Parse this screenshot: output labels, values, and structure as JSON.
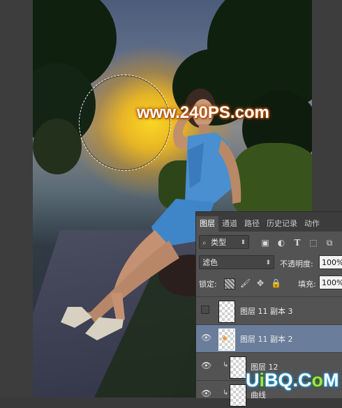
{
  "watermarks": {
    "top": "www.240PS.com",
    "bottom_part1": "U",
    "bottom_part2": "i",
    "bottom_part3": "BQ.C",
    "bottom_part4": "o",
    "bottom_part5": "M"
  },
  "layers_panel": {
    "tabs": [
      {
        "label": "图层",
        "active": true
      },
      {
        "label": "通道",
        "active": false
      },
      {
        "label": "路径",
        "active": false
      },
      {
        "label": "历史记录",
        "active": false
      },
      {
        "label": "动作",
        "active": false
      }
    ],
    "filter": {
      "label": "类型",
      "icon": "search-icon"
    },
    "blend_mode": "滤色",
    "opacity_label": "不透明度:",
    "opacity_value": "100%",
    "lock_label": "锁定:",
    "fill_label": "填充:",
    "fill_value": "100%",
    "layers": [
      {
        "name": "图层 11 副本 3",
        "visible": false,
        "selected": false,
        "clipped": false
      },
      {
        "name": "图层 11 副本 2",
        "visible": true,
        "selected": true,
        "clipped": false
      },
      {
        "name": "图层 12",
        "visible": true,
        "selected": false,
        "clipped": true
      },
      {
        "name": "曲线",
        "visible": true,
        "selected": false,
        "clipped": true
      }
    ]
  },
  "colors": {
    "panel_bg": "#535353",
    "selected_layer": "#6a7d9a",
    "glow": "#ffd21e"
  }
}
